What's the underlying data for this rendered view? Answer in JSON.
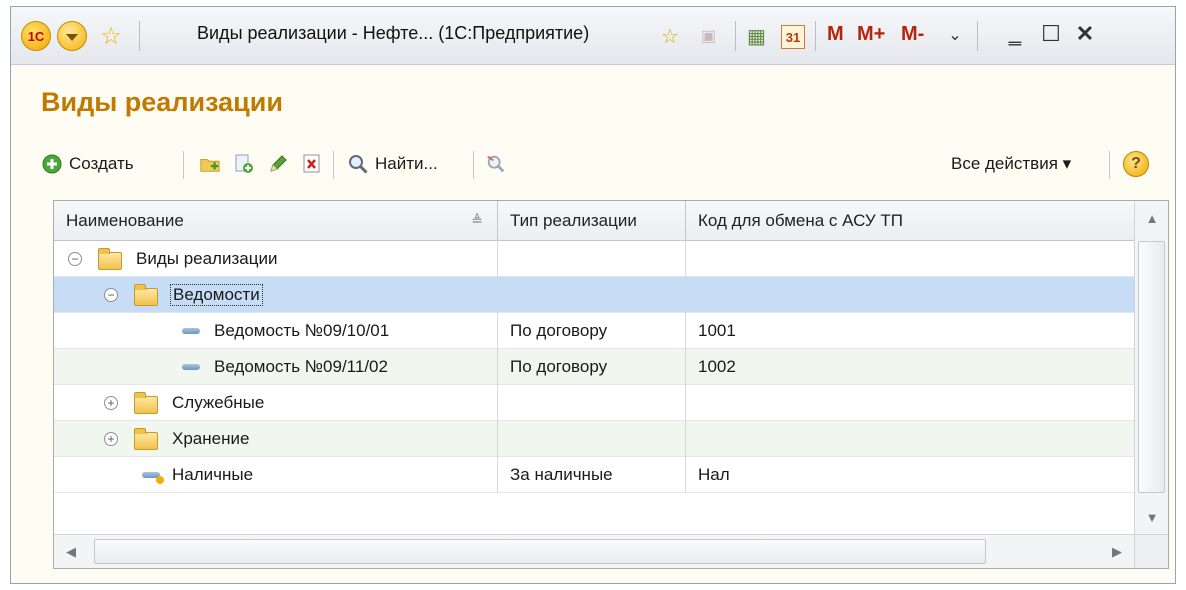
{
  "window": {
    "title": "Виды реализации - Нефте... (1С:Предприятие)",
    "logo_text": "1С",
    "m_label": "M",
    "mplus_label": "M+",
    "mminus_label": "M-"
  },
  "page": {
    "title": "Виды реализации"
  },
  "toolbar": {
    "create_label": "Создать",
    "find_label": "Найти...",
    "all_actions_label": "Все действия ▾",
    "help_label": "?"
  },
  "table": {
    "columns": [
      "Наименование",
      "Тип реализации",
      "Код для обмена с АСУ ТП"
    ],
    "rows": [
      {
        "name": "Виды реализации",
        "type": "",
        "code": ""
      },
      {
        "name": "Ведомости",
        "type": "",
        "code": ""
      },
      {
        "name": "Ведомость №09/10/01",
        "type": "По договору",
        "code": "1001"
      },
      {
        "name": "Ведомость №09/11/02",
        "type": "По договору",
        "code": "1002"
      },
      {
        "name": "Служебные",
        "type": "",
        "code": ""
      },
      {
        "name": "Хранение",
        "type": "",
        "code": ""
      },
      {
        "name": "Наличные",
        "type": "За наличные",
        "code": "Нал"
      }
    ]
  },
  "colors": {
    "accent": "#c07a00",
    "selected_row": "#c7dcf5",
    "alt_row": "#f1f6ee"
  }
}
